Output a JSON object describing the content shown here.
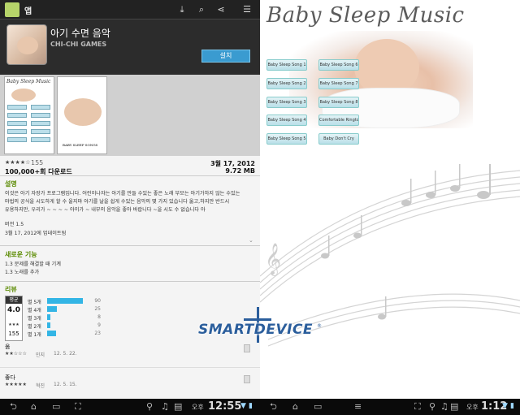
{
  "left": {
    "actionbar": {
      "title": "앱",
      "icons": [
        "download-icon",
        "search-icon",
        "share-icon",
        "overflow-menu-icon"
      ]
    },
    "app": {
      "name": "아기 수면 음악",
      "developer": "CHI-CHI GAMES",
      "install_label": "설치"
    },
    "stats": {
      "stars": "★★★★☆",
      "rating_count": "155",
      "downloads": "100,000+회 다운로드",
      "date": "3월 17, 2012",
      "size": "9.72 MB"
    },
    "description": {
      "title": "설명",
      "lines": [
        "이것은 아기 자장가 프로그램입니다. 어린이나자는 아기를 만들 수있는 좋은 노래 부모는 아기가하지 않는 수있는",
        "마법의 공식을 시도하게 할 수 울지마 아기를 날을 쉽게 수있는 음악의 몇 가지 있습니다 옮고,하지만 반드시",
        "유용하지만, 우리가 ~ ~ ~ ~ 아이가 ~ 내부의 음악을 좋아 바랍니다 ~을 시도 수 없습니다 아"
      ],
      "version": "버전 1.5",
      "updated": "3월 17, 2012에 업데이트됨"
    },
    "whats_new": {
      "title": "새로운 기능",
      "lines": [
        "1.3 문제를 해결할 때 기계",
        "1.3 노래를 추가"
      ]
    },
    "reviews": {
      "title": "리뷰",
      "average_label": "평균",
      "average": "4.0",
      "average_stars": "★★★",
      "total": "155",
      "histogram": [
        {
          "label": "별 5개",
          "count": "90",
          "fraction": 1.0
        },
        {
          "label": "별 4개",
          "count": "25",
          "fraction": 0.28
        },
        {
          "label": "별 3개",
          "count": "8",
          "fraction": 0.09
        },
        {
          "label": "별 2개",
          "count": "9",
          "fraction": 0.1
        },
        {
          "label": "별 1개",
          "count": "23",
          "fraction": 0.26
        }
      ],
      "items": [
        {
          "title": "옴",
          "stars": "★★☆☆☆",
          "author": "민지",
          "date": "12. 5. 22."
        },
        {
          "title": "좋다",
          "stars": "★★★★★",
          "author": "혁진",
          "date": "12. 5. 15."
        }
      ]
    },
    "screenshot_title": "Baby Sleep Music",
    "screenshot_caption": "BABY SLEEP SONGS",
    "systembar": {
      "time": "12:55",
      "ampm": "오후"
    }
  },
  "right": {
    "title": "Baby Sleep Music",
    "songs_left": [
      "Baby Sleep Song 1",
      "Baby Sleep Song 2",
      "Baby Sleep Song 3",
      "Baby Sleep Song 4",
      "Baby Sleep Song 5"
    ],
    "songs_right": [
      "Baby Sleep Song 6",
      "Baby Sleep Song 7",
      "Baby Sleep Song 8",
      "Comfortable Ringtones",
      "Baby Don't Cry"
    ],
    "systembar": {
      "time": "1:12",
      "ampm": "오후"
    }
  },
  "watermark": {
    "text": "SMARTDEVICE",
    "reg": "®"
  },
  "colors": {
    "accent_green": "#5a8a00",
    "install_blue": "#3a9bd0",
    "bar_blue": "#33b5e5",
    "watermark_blue": "#2b5e9c"
  }
}
